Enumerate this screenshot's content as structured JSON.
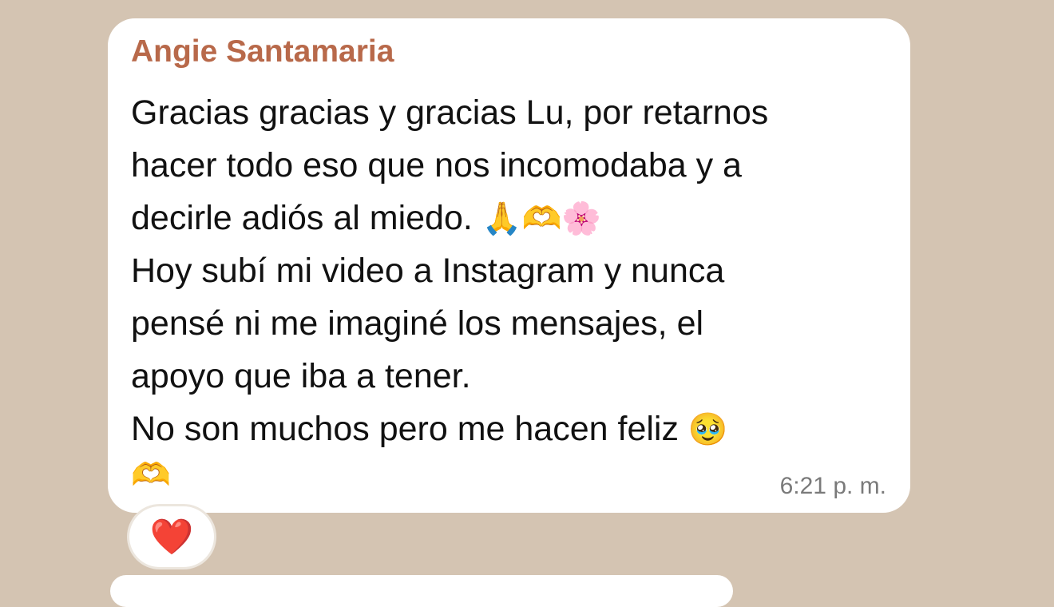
{
  "message": {
    "sender": "Angie Santamaria",
    "lines": [
      "Gracias gracias y gracias Lu, por retarnos",
      "hacer todo eso que nos incomodaba y a",
      "decirle adiós al miedo.",
      "Hoy subí mi video a Instagram y nunca",
      "pensé ni me imaginé los mensajes, el",
      "apoyo que iba a tener.",
      "No son muchos pero me hacen feliz"
    ],
    "line3_emojis": [
      "🙏",
      "🫶",
      "🌸"
    ],
    "line7_emoji": "🥹",
    "trailing_emoji": "🫶",
    "time": "6:21 p. m."
  },
  "reaction": {
    "emoji": "❤️"
  },
  "colors": {
    "background": "#d4c4b2",
    "bubble": "#ffffff",
    "sender": "#b8694a",
    "text": "#111111",
    "timestamp": "#7a7a7a"
  }
}
